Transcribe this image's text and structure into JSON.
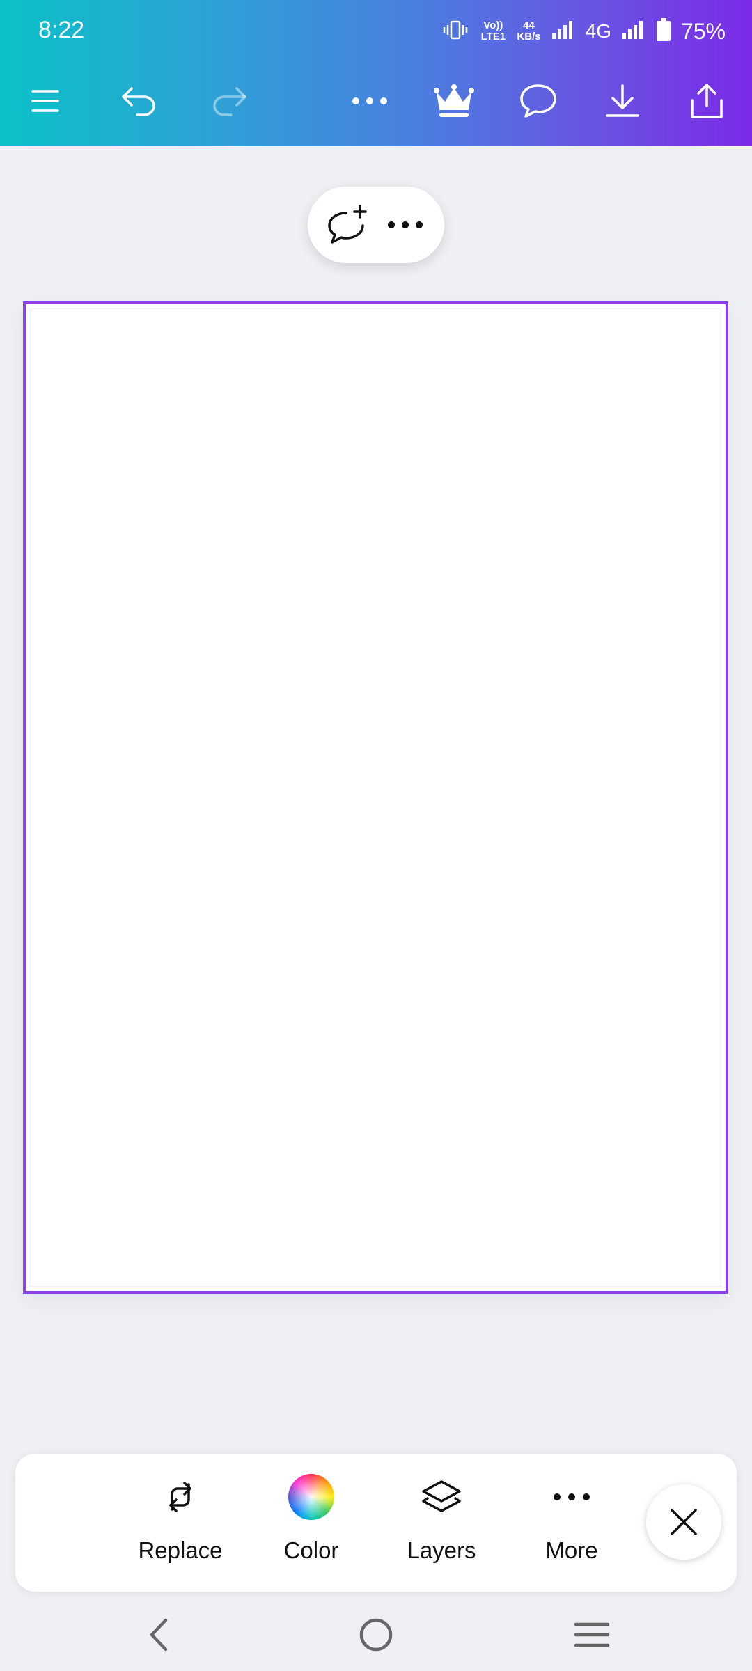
{
  "status_bar": {
    "time": "8:22",
    "volte": "Vo)) LTE1",
    "speed_value": "44",
    "speed_unit": "KB/s",
    "network": "4G",
    "battery": "75%"
  },
  "toolbar": {
    "icons": [
      "menu-icon",
      "undo-icon",
      "redo-icon",
      "more-icon",
      "crown-icon",
      "comment-icon",
      "download-icon",
      "share-icon"
    ]
  },
  "floating_toolbar": {
    "icons": [
      "add-comment-icon",
      "more-icon"
    ]
  },
  "bottom_tools": {
    "items": [
      {
        "label": "Replace",
        "icon": "replace-icon"
      },
      {
        "label": "Color",
        "icon": "color-wheel-icon"
      },
      {
        "label": "Layers",
        "icon": "layers-icon"
      },
      {
        "label": "More",
        "icon": "more-icon"
      }
    ]
  },
  "nav_bar": {
    "icons": [
      "back-icon",
      "home-icon",
      "recents-icon"
    ]
  },
  "colors": {
    "accent": "#8b3fe8",
    "gradient_start": "#0bc1c8",
    "gradient_end": "#7c2ae8",
    "background": "#eff0f4"
  }
}
